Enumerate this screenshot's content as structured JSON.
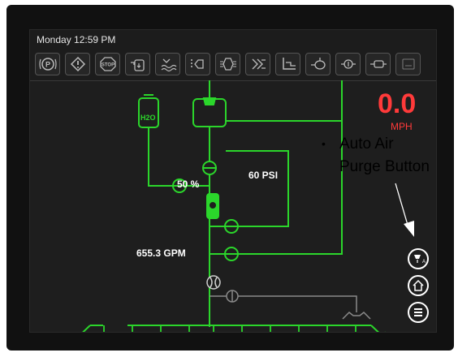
{
  "status_bar": {
    "datetime": "Monday 12:59 PM",
    "icons": [
      "parking-brake-icon",
      "warning-icon",
      "stop-icon",
      "tank-fill-icon",
      "tank-rinse-icon",
      "boom-section-icon",
      "spray-flow-icon",
      "agitation-icon",
      "boom-fold-icon",
      "pump-icon",
      "filter-icon",
      "air-purge-status-icon",
      "foam-marker-icon"
    ]
  },
  "speed": {
    "value": "0.0",
    "unit": "MPH"
  },
  "readouts": {
    "valve_percent": "50 %",
    "pressure": "60 PSI",
    "flow": "655.3 GPM"
  },
  "tanks": {
    "rinse_label": "H2O"
  },
  "nav_buttons": [
    "auto-air-purge-icon",
    "home-icon",
    "menu-icon"
  ],
  "annotation": {
    "bullet": "•",
    "line1": "Auto Air",
    "line2": "Purge Button"
  },
  "colors": {
    "plumbing": "#2bd62b",
    "speed": "#ff3a3a",
    "inactive_line": "#8a8a8a",
    "screen_bg": "#1e1e1e"
  }
}
